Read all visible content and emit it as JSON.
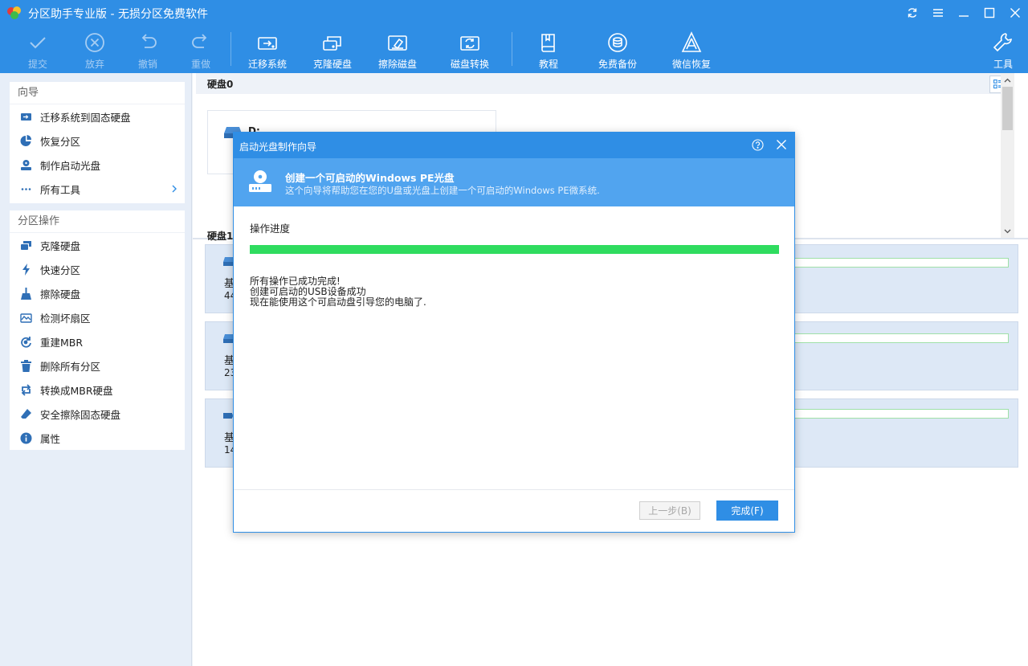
{
  "window": {
    "title": "分区助手专业版 - 无损分区免费软件"
  },
  "toolbar": {
    "items": [
      {
        "label": "提交",
        "icon": "check-icon",
        "enabled": false
      },
      {
        "label": "放弃",
        "icon": "cancel-circle-icon",
        "enabled": false
      },
      {
        "label": "撤销",
        "icon": "undo-icon",
        "enabled": false
      },
      {
        "label": "重做",
        "icon": "redo-icon",
        "enabled": false
      },
      {
        "label": "迁移系统",
        "icon": "migrate-system-icon",
        "enabled": true
      },
      {
        "label": "克隆硬盘",
        "icon": "clone-disk-icon",
        "enabled": true
      },
      {
        "label": "擦除磁盘",
        "icon": "wipe-disk-icon",
        "enabled": true
      },
      {
        "label": "磁盘转换",
        "icon": "disk-convert-icon",
        "enabled": true
      },
      {
        "label": "教程",
        "icon": "tutorial-book-icon",
        "enabled": true
      },
      {
        "label": "免费备份",
        "icon": "backup-icon",
        "enabled": true
      },
      {
        "label": "微信恢复",
        "icon": "recovery-icon",
        "enabled": true
      },
      {
        "label": "工具",
        "icon": "wrench-icon",
        "enabled": true
      }
    ]
  },
  "sidebar": {
    "wizard": {
      "title": "向导",
      "items": [
        {
          "label": "迁移系统到固态硬盘",
          "icon": "migrate-ssd-icon"
        },
        {
          "label": "恢复分区",
          "icon": "pie-recover-icon"
        },
        {
          "label": "制作启动光盘",
          "icon": "bootable-disc-icon"
        },
        {
          "label": "所有工具",
          "icon": "more-dots-icon"
        }
      ]
    },
    "operations": {
      "title": "分区操作",
      "items": [
        {
          "label": "克隆硬盘",
          "icon": "clone-disk-icon"
        },
        {
          "label": "快速分区",
          "icon": "lightning-icon"
        },
        {
          "label": "擦除硬盘",
          "icon": "broom-icon"
        },
        {
          "label": "检测坏扇区",
          "icon": "scan-sector-icon"
        },
        {
          "label": "重建MBR",
          "icon": "rebuild-mbr-icon"
        },
        {
          "label": "删除所有分区",
          "icon": "trash-icon"
        },
        {
          "label": "转换成MBR硬盘",
          "icon": "convert-icon"
        },
        {
          "label": "安全擦除固态硬盘",
          "icon": "eraser-icon"
        },
        {
          "label": "属性",
          "icon": "info-icon"
        }
      ]
    }
  },
  "main": {
    "disk0_label": "硬盘0",
    "partition_card": {
      "name": "D:"
    },
    "disk1_label": "硬盘1",
    "disks": [
      {
        "name": "基",
        "size": "44"
      },
      {
        "name": "基",
        "size": "23"
      },
      {
        "name": "基",
        "size": "14"
      }
    ]
  },
  "dialog": {
    "title": "启动光盘制作向导",
    "banner_heading": "创建一个可启动的Windows PE光盘",
    "banner_sub": "这个向导将帮助您在您的U盘或光盘上创建一个可启动的Windows PE微系统.",
    "progress_label": "操作进度",
    "progress_fraction": 1.0,
    "messages": [
      "所有操作已成功完成!",
      "创建可启动的USB设备成功",
      "现在能使用这个可启动盘引导您的电脑了."
    ],
    "prev_button": "上一步(B)",
    "finish_button": "完成(F)"
  },
  "colors": {
    "accent": "#2f8ee5",
    "progress": "#2fdc5f",
    "banner": "#51a4ef"
  }
}
